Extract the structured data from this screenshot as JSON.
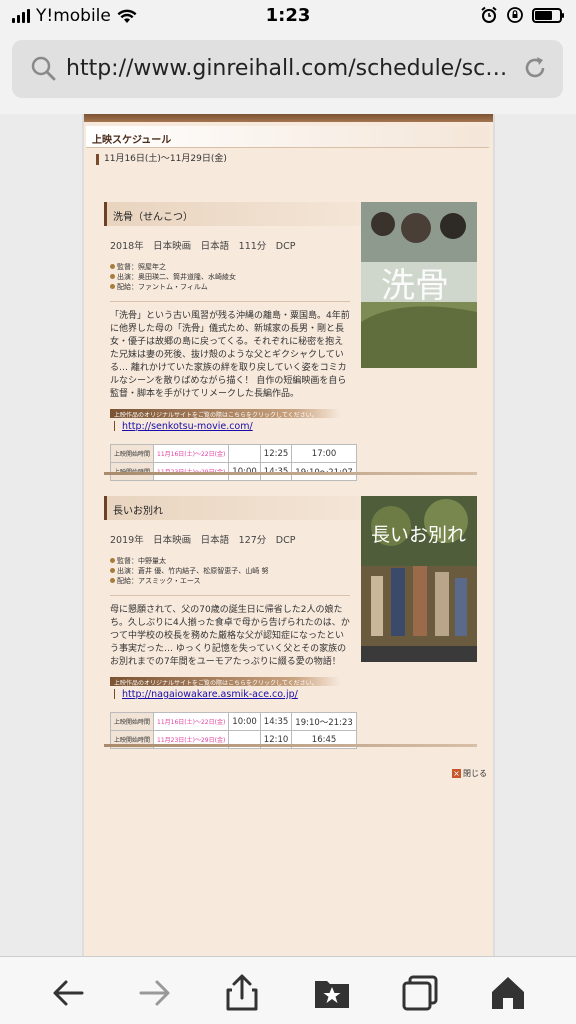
{
  "status_bar": {
    "carrier": "Y!mobile",
    "time": "1:23",
    "battery_level": 0.7
  },
  "browser": {
    "url": "http://www.ginreihall.com/schedule/sche..."
  },
  "page": {
    "section_title": "上映スケジュール",
    "date_range": "11月16日(土)〜11月29日(金)",
    "close_label": "閉じる",
    "films": [
      {
        "title": "洗骨（せんこつ）",
        "spec": "2018年　日本映画　日本語　111分　DCP",
        "credits": [
          "監督：照屋年之",
          "出演：奥田瑛二、筒井道隆、水崎綾女",
          "配給：ファントム・フィルム"
        ],
        "synopsis": "「洗骨」という古い風習が残る沖縄の離島・粟国島。4年前に他界した母の「洗骨」儀式ため、新城家の長男・剛と長女・優子は故郷の島に戻ってくる。それぞれに秘密を抱えた兄妹は妻の死後、抜け殻のような父とギクシャクしている… 離れかけていた家族の絆を取り戻していく姿をコミカルなシーンを散りばめながら描く！ 自作の短編映画を自ら監督・脚本を手がけてリメークした長編作品。",
        "site_note": "上映作品のオリジナルサイトをご覧の際はこちらをクリックしてください。",
        "link": "http://senkotsu-movie.com/",
        "schedule": [
          {
            "label": "上映開始時間",
            "dates": "11月16日(土)〜22日(金)",
            "times": [
              "",
              "12:25",
              "17:00"
            ]
          },
          {
            "label": "上映開始時間",
            "dates": "11月23日(土)〜29日(金)",
            "times": [
              "10:00",
              "14:35",
              "19:10〜21:07"
            ]
          }
        ]
      },
      {
        "title": "長いお別れ",
        "spec": "2019年　日本映画　日本語　127分　DCP",
        "credits": [
          "監督：中野量太",
          "出演：蒼井 優、竹内結子、松原智恵子、山崎 努",
          "配給：アスミック・エース"
        ],
        "synopsis": "母に懇願されて、父の70歳の誕生日に帰省した2人の娘たち。久しぶりに4人揃った食卓で母から告げられたのは、かつて中学校の校長を務めた厳格な父が認知症になったという事実だった… ゆっくり記憶を失っていく父とその家族のお別れまでの7年間をユーモアたっぷりに綴る愛の物語！",
        "site_note": "上映作品のオリジナルサイトをご覧の際はこちらをクリックしてください。",
        "link": "http://nagaiowakare.asmik-ace.co.jp/",
        "schedule": [
          {
            "label": "上映開始時間",
            "dates": "11月16日(土)〜22日(金)",
            "times": [
              "10:00",
              "14:35",
              "19:10〜21:23"
            ]
          },
          {
            "label": "上映開始時間",
            "dates": "11月23日(土)〜29日(金)",
            "times": [
              "",
              "12:10",
              "16:45"
            ]
          }
        ]
      }
    ]
  },
  "colors": {
    "paper": "#f7e9dc",
    "accent_brown": "#7b5232",
    "date_pink": "#e040a0",
    "link_blue": "#1a0dab"
  },
  "toolbar": {
    "icons": [
      "back-icon",
      "forward-icon",
      "share-icon",
      "bookmarks-icon",
      "tabs-icon",
      "home-icon"
    ]
  }
}
